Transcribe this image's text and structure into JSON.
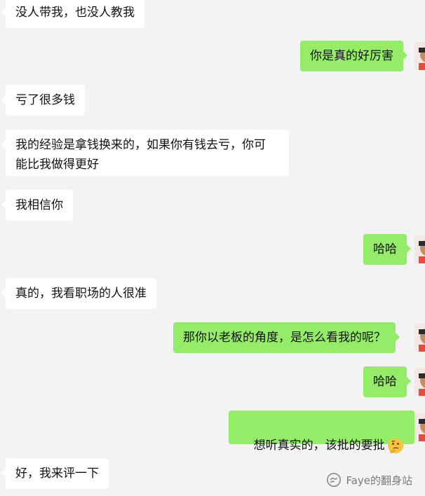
{
  "messages": [
    {
      "id": "m1",
      "side": "incoming",
      "text": "没人带我，也没人教我"
    },
    {
      "id": "m2",
      "side": "outgoing",
      "text": "你是真的好厉害"
    },
    {
      "id": "m3",
      "side": "incoming",
      "text": "亏了很多钱"
    },
    {
      "id": "m4",
      "side": "incoming",
      "text": "我的经验是拿钱换来的，如果你有钱去亏，你可\n能比我做得更好"
    },
    {
      "id": "m5",
      "side": "incoming",
      "text": "我相信你"
    },
    {
      "id": "m6",
      "side": "outgoing",
      "text": "哈哈"
    },
    {
      "id": "m7",
      "side": "incoming",
      "text": "真的，我看职场的人很准"
    },
    {
      "id": "m8",
      "side": "outgoing",
      "text": "那你以老板的角度，是怎么看我的呢？"
    },
    {
      "id": "m9",
      "side": "outgoing",
      "text": "哈哈"
    },
    {
      "id": "m10",
      "side": "outgoing",
      "text": "想听真实的，该批的要批",
      "emoji": "thinking-face-emoji"
    },
    {
      "id": "m11",
      "side": "incoming",
      "text": "好，我来评一下"
    }
  ],
  "watermark": {
    "icon": "wechat-official-account-icon",
    "text": "Faye的翻身站"
  },
  "colors": {
    "background": "#f3f3f3",
    "incoming_bubble": "#ffffff",
    "outgoing_bubble": "#95ec69",
    "text": "#111111"
  }
}
